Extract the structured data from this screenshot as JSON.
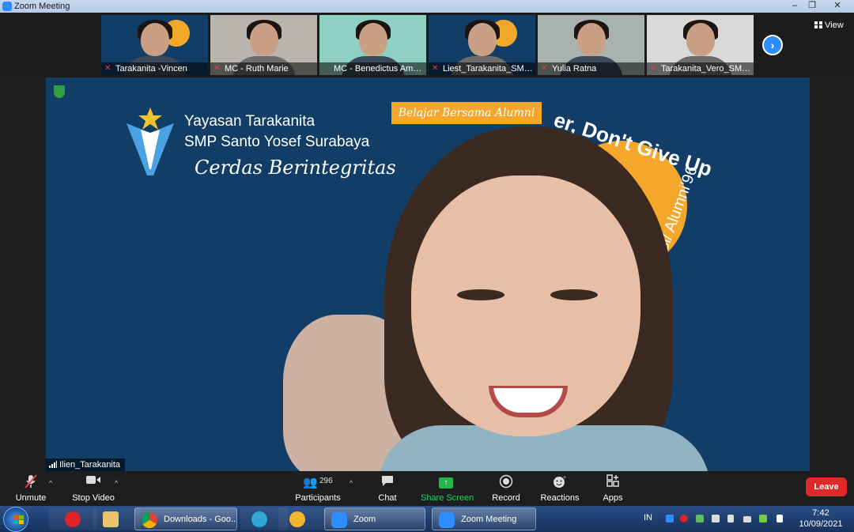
{
  "window": {
    "title": "Zoom Meeting",
    "minimize": "–",
    "restore": "❐",
    "close": "✕"
  },
  "gallery": {
    "view_label": "View",
    "next_label": "›",
    "participants": [
      {
        "name": "Tarakanita -Vincen",
        "bg": "#123d66",
        "muted": true,
        "has_poster": true
      },
      {
        "name": "MC - Ruth Marie",
        "bg": "#b9b4ad",
        "muted": true,
        "has_poster": false
      },
      {
        "name": "MC - Benedictus Amadeus",
        "bg": "#8ed0c2",
        "muted": false,
        "has_poster": false
      },
      {
        "name": "Liest_Tarakanita_SMP ...",
        "bg": "#123d66",
        "muted": true,
        "has_poster": true
      },
      {
        "name": "Yulia Ratna",
        "bg": "#a9b3ad",
        "muted": true,
        "has_poster": false
      },
      {
        "name": "Tarakanita_Vero_SMP...",
        "bg": "#d9d9d9",
        "muted": true,
        "has_poster": false
      }
    ]
  },
  "main": {
    "speaker_name": "Ilien_Tarakanita",
    "poster": {
      "org_line1": "Yayasan Tarakanita",
      "org_line2": "SMP Santo Yosef Surabaya",
      "motto": "Cerdas Berintegritas",
      "banner": "Belajar Bersama Alumni",
      "headline_fragment": "er, Don't Give Up",
      "alumni_fragment": "nesi/ Alumni'96"
    }
  },
  "toolbar": {
    "unmute": "Unmute",
    "stop_video": "Stop Video",
    "participants": "Participants",
    "participant_count": "296",
    "chat": "Chat",
    "share_screen": "Share Screen",
    "record": "Record",
    "reactions": "Reactions",
    "apps": "Apps",
    "leave": "Leave"
  },
  "taskbar": {
    "items": [
      {
        "label": "Downloads - Goo...",
        "type": "chrome"
      },
      {
        "label": "Zoom",
        "type": "zoom"
      },
      {
        "label": "Zoom Meeting",
        "type": "zoom"
      }
    ],
    "input_lang": "IN",
    "time": "7:42",
    "date": "10/09/2021"
  },
  "colors": {
    "zoom_blue": "#2d8cff",
    "leave_red": "#e02828",
    "share_green": "#23b54a",
    "poster_blue": "#123d66",
    "poster_orange": "#f4a72b"
  }
}
